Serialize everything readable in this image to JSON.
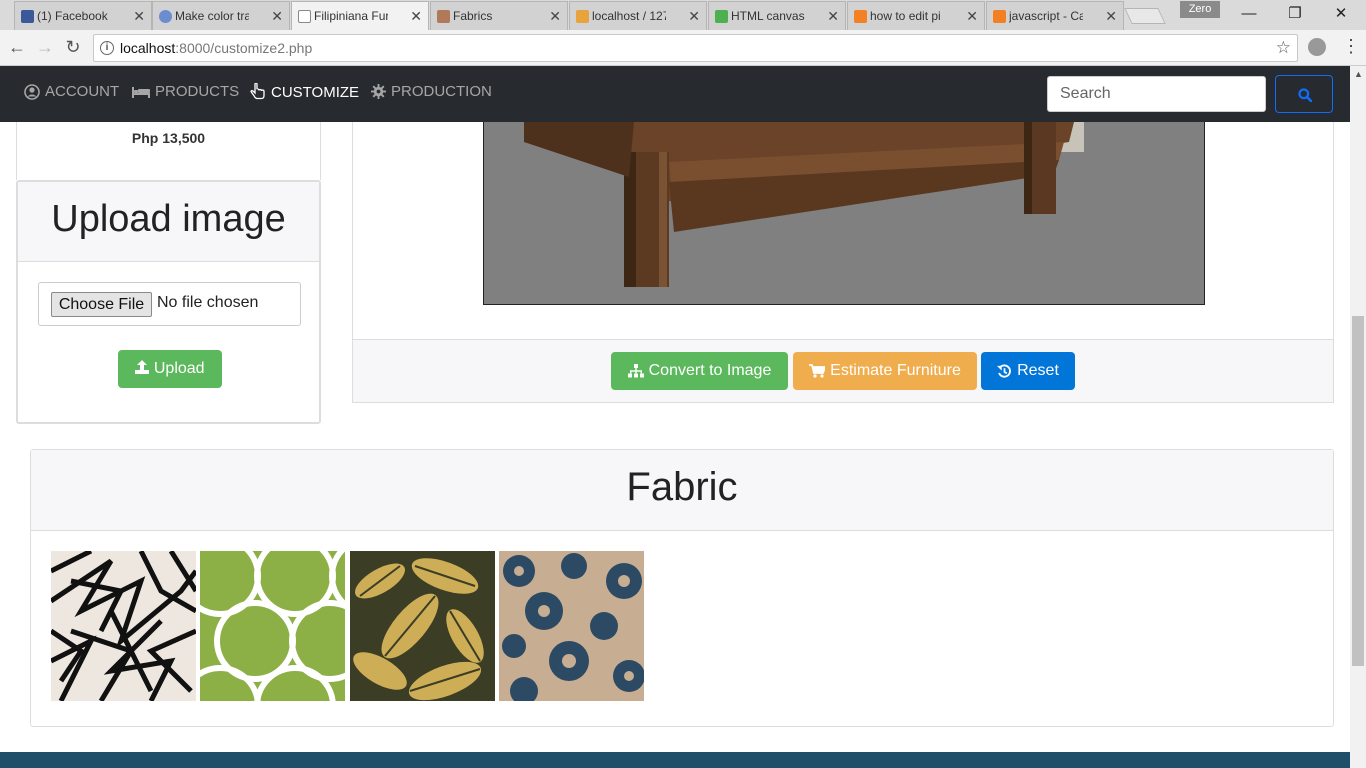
{
  "browser": {
    "tabs": [
      {
        "label": "(1) Facebook",
        "favicon": "facebook-icon",
        "color": "#3b5998"
      },
      {
        "label": "Make color tra",
        "favicon": "cloud-icon",
        "color": "#6b8ccf"
      },
      {
        "label": "Filipiniana Furn",
        "favicon": "page-icon",
        "color": "#888888",
        "active": true
      },
      {
        "label": "Fabrics",
        "favicon": "chair-icon",
        "color": "#b07a5a"
      },
      {
        "label": "localhost / 127",
        "favicon": "phpmyadmin-icon",
        "color": "#e8a33c"
      },
      {
        "label": "HTML canvas c",
        "favicon": "w3-icon",
        "color": "#4caf50"
      },
      {
        "label": "how to edit pi",
        "favicon": "stackoverflow-icon",
        "color": "#f48024"
      },
      {
        "label": "javascript - Ca",
        "favicon": "stackoverflow-icon",
        "color": "#f48024"
      }
    ],
    "profile": "Zero",
    "url_host": "localhost",
    "url_path": ":8000/customize2.php"
  },
  "nav": {
    "items": [
      {
        "label": "ACCOUNT",
        "icon": "user-circle-icon"
      },
      {
        "label": "PRODUCTS",
        "icon": "bed-icon"
      },
      {
        "label": "CUSTOMIZE",
        "icon": "hand-pointer-icon",
        "active": true
      },
      {
        "label": "PRODUCTION",
        "icon": "gear-icon"
      }
    ],
    "search_placeholder": "Search"
  },
  "product": {
    "price": "Php 13,500"
  },
  "upload": {
    "title": "Upload image",
    "choose_label": "Choose File",
    "no_file": "No file chosen",
    "upload_label": "Upload"
  },
  "actions": {
    "convert_label": "Convert to Image",
    "estimate_label": "Estimate Furniture",
    "reset_label": "Reset"
  },
  "fabric": {
    "title": "Fabric",
    "swatches": [
      {
        "name": "black-geometric",
        "colors": [
          "#ede7e0",
          "#111111"
        ]
      },
      {
        "name": "green-circles",
        "colors": [
          "#8db046",
          "#ffffff"
        ]
      },
      {
        "name": "gold-leaves",
        "colors": [
          "#3b3d24",
          "#d6b35a"
        ]
      },
      {
        "name": "navy-floral",
        "colors": [
          "#c7ad92",
          "#2c4a63"
        ]
      }
    ]
  }
}
